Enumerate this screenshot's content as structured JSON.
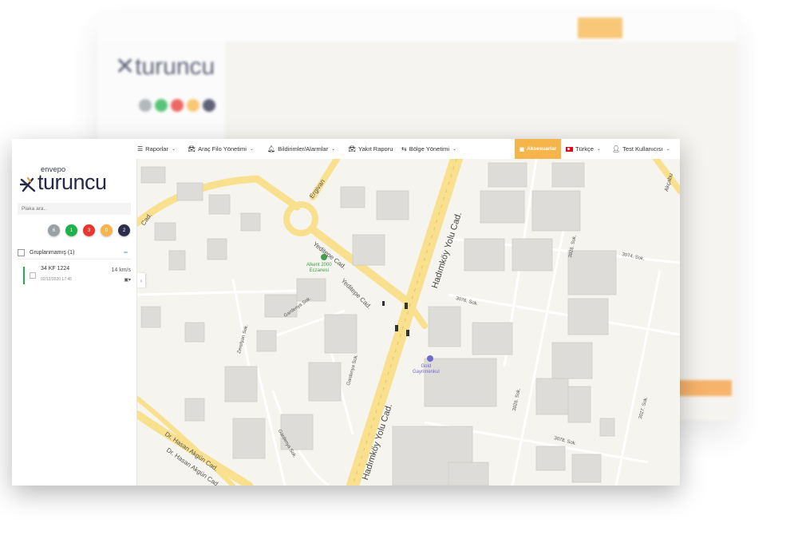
{
  "nav": {
    "reports": "Raporlar",
    "fleet": "Araç Filo Yönetimi",
    "notifications": "Bildirimler/Alarmlar",
    "fuel": "Yakıt Raporu",
    "region": "Bölge Yönetimi",
    "accessories": "Aksesuarlar",
    "language": "Türkçe",
    "user": "Test Kullanıcısı"
  },
  "logo": {
    "small": "envepo",
    "main": "turuncu"
  },
  "search": {
    "placeholder": "Plaka ara.."
  },
  "status_counts": [
    {
      "value": "6",
      "color": "#9aa1a6"
    },
    {
      "value": "1",
      "color": "#1fb14b"
    },
    {
      "value": "3",
      "color": "#e8372f"
    },
    {
      "value": "0",
      "color": "#f6b54a"
    },
    {
      "value": "2",
      "color": "#2b2f4c"
    }
  ],
  "group": {
    "label": "Gruplanmamış (1)",
    "toggle": "−"
  },
  "vehicle": {
    "plate": "34 KF 1224",
    "timestamp": "02/12/2020 17:45",
    "speed": "14 km/s",
    "icons": "▣▾"
  },
  "map": {
    "streets": {
      "hadimkoy1": "Hadımköy Yolu Cad.",
      "hadimkoy2": "Hadımköy Yolu Cad.",
      "yeditepe1": "Yeditepe Cad.",
      "yeditepe2": "Yeditepe Cad.",
      "ergivan": "Ergivan",
      "gardenya1": "Gardenya Sok.",
      "gardenya2": "Gardenya Sok.",
      "gardenya3": "Gardenya Sok.",
      "zerefsan": "Zerefşan Sok.",
      "dr1": "Dr. Hasan Akgün Cad.",
      "dr2": "Dr. Hasan Akgün Cad.",
      "s3076a": "3076. Sok.",
      "s3074": "3074. Sok.",
      "s3026a": "3026. Sok.",
      "s3026b": "3026. Sok.",
      "s3078": "3078. Sok.",
      "s3027": "3027. Sok.",
      "cad": "Cad.",
      "akcabu": "Akçabu"
    },
    "poi_pharmacy": "Alkent 2000\nEczanesi",
    "poi_realestate": "Gold\nGayrimenkul",
    "collapse": "‹"
  },
  "colors": {
    "accent": "#f6b54a",
    "road": "#f8e08e",
    "building": "#dedcd8"
  }
}
